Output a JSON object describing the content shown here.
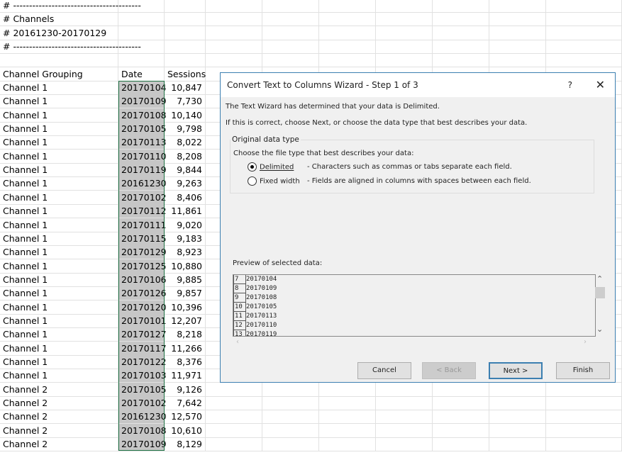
{
  "sheet": {
    "header_lines": [
      "# ----------------------------------------",
      "# Channels",
      "# 20161230-20170129",
      "# ----------------------------------------"
    ],
    "columns": [
      "Channel Grouping",
      "Date",
      "Sessions"
    ],
    "rows": [
      [
        "Channel 1",
        "20170104",
        "10,847"
      ],
      [
        "Channel 1",
        "20170109",
        "7,730"
      ],
      [
        "Channel 1",
        "20170108",
        "10,140"
      ],
      [
        "Channel 1",
        "20170105",
        "9,798"
      ],
      [
        "Channel 1",
        "20170113",
        "8,022"
      ],
      [
        "Channel 1",
        "20170110",
        "8,208"
      ],
      [
        "Channel 1",
        "20170119",
        "9,844"
      ],
      [
        "Channel 1",
        "20161230",
        "9,263"
      ],
      [
        "Channel 1",
        "20170102",
        "8,406"
      ],
      [
        "Channel 1",
        "20170112",
        "11,861"
      ],
      [
        "Channel 1",
        "20170111",
        "9,020"
      ],
      [
        "Channel 1",
        "20170115",
        "9,183"
      ],
      [
        "Channel 1",
        "20170129",
        "8,923"
      ],
      [
        "Channel 1",
        "20170125",
        "10,880"
      ],
      [
        "Channel 1",
        "20170106",
        "9,885"
      ],
      [
        "Channel 1",
        "20170126",
        "9,857"
      ],
      [
        "Channel 1",
        "20170120",
        "10,396"
      ],
      [
        "Channel 1",
        "20170101",
        "12,207"
      ],
      [
        "Channel 1",
        "20170127",
        "8,218"
      ],
      [
        "Channel 1",
        "20170117",
        "11,266"
      ],
      [
        "Channel 1",
        "20170122",
        "8,376"
      ],
      [
        "Channel 1",
        "20170103",
        "11,971"
      ],
      [
        "Channel 2",
        "20170105",
        "9,126"
      ],
      [
        "Channel 2",
        "20170102",
        "7,642"
      ],
      [
        "Channel 2",
        "20161230",
        "12,570"
      ],
      [
        "Channel 2",
        "20170108",
        "10,610"
      ],
      [
        "Channel 2",
        "20170109",
        "8,129"
      ]
    ]
  },
  "dialog": {
    "title": "Convert Text to Columns Wizard - Step 1 of 3",
    "help": "?",
    "close": "✕",
    "line1": "The Text Wizard has determined that your data is Delimited.",
    "line2": "If this is correct, choose Next, or choose the data type that best describes your data.",
    "group_label": "Original data type",
    "choose_label": "Choose the file type that best describes your data:",
    "options": [
      {
        "label": "Delimited",
        "desc": "- Characters such as commas or tabs separate each field.",
        "selected": true
      },
      {
        "label": "Fixed width",
        "desc": "- Fields are aligned in columns with spaces between each field.",
        "selected": false
      }
    ],
    "preview_label": "Preview of selected data:",
    "preview": [
      [
        "7",
        "20170104"
      ],
      [
        "8",
        "20170109"
      ],
      [
        "9",
        "20170108"
      ],
      [
        "10",
        "20170105"
      ],
      [
        "11",
        "20170113"
      ],
      [
        "12",
        "20170110"
      ],
      [
        "13",
        "20170119"
      ]
    ],
    "buttons": {
      "cancel": "Cancel",
      "back": "< Back",
      "next": "Next >",
      "finish": "Finish"
    }
  }
}
